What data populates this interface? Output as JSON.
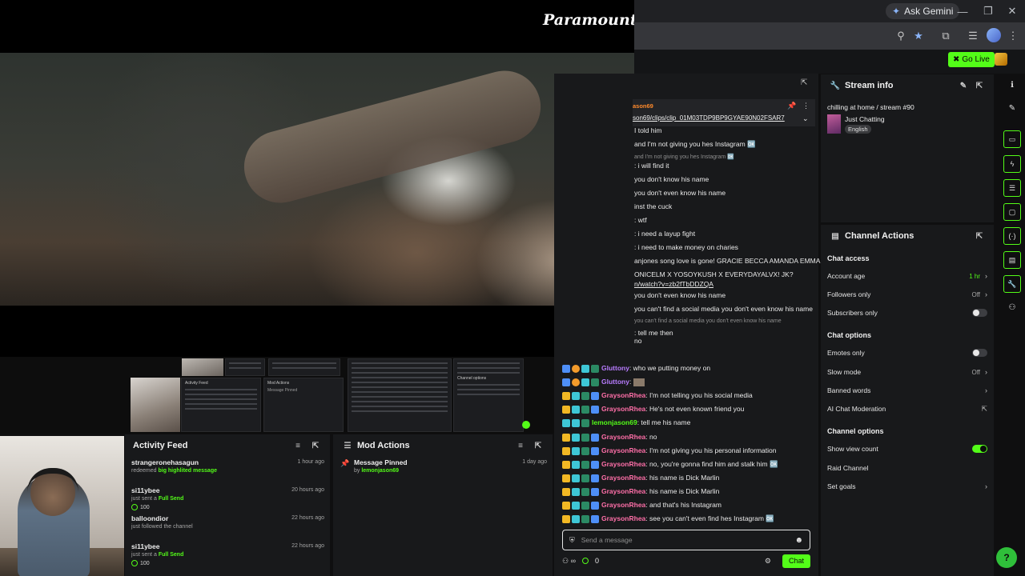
{
  "browser": {
    "ask_gemini": "Ask Gemini",
    "minimize": "—",
    "restore": "❐",
    "close": "✕"
  },
  "video": {
    "logo": "Paramount+"
  },
  "topbar": {
    "go_live": "Go Live"
  },
  "mini": {
    "activity_title": "Activity Feed",
    "mod_title": "Mod Actions",
    "mod_item": "Message Pinned",
    "ch_options": "Channel options"
  },
  "activity_feed": {
    "title": "Activity Feed",
    "items": [
      {
        "name": "strangeronehasagun",
        "time": "1 hour ago",
        "pre": "redeemed ",
        "highlight": "big highlited message",
        "amount": ""
      },
      {
        "name": "si11ybee",
        "time": "20 hours ago",
        "pre": "just sent a ",
        "highlight": "Full Send",
        "amount": "100"
      },
      {
        "name": "balloondior",
        "time": "22 hours ago",
        "pre": "just followed the channel",
        "highlight": "",
        "amount": ""
      },
      {
        "name": "si11ybee",
        "time": "22 hours ago",
        "pre": "just sent a ",
        "highlight": "Full Send",
        "amount": "100"
      }
    ]
  },
  "mod_actions": {
    "title": "Mod Actions",
    "items": [
      {
        "name": "Message Pinned",
        "by": "by ",
        "user": "lemonjason69",
        "time": "1 day ago"
      }
    ]
  },
  "chat": {
    "pinned_user": "ason69",
    "pinned_link": "son69/clips/clip_01M03TDP9BP9GYAE90N02FSAR7",
    "partial_lines": [
      {
        "text": "I told him",
        "dim": false
      },
      {
        "text": "and I'm not giving you hes Instagram 🆗",
        "dim": false
      },
      {
        "text": "and I'm not giving you hes Instagram 🆗",
        "dim": true
      },
      {
        "text": ": i will find it",
        "dim": false
      },
      {
        "text": "you don't know his name",
        "dim": false
      },
      {
        "text": "you don't even know his name",
        "dim": false
      },
      {
        "text": "inst the cuck",
        "dim": false
      },
      {
        "text": ": wtf",
        "dim": false
      },
      {
        "text": ": i need a layup fight",
        "dim": false
      },
      {
        "text": ": i need to make money on charies",
        "dim": false
      },
      {
        "text": "anjones song love is gone! GRACIE BECCA AMANDA EMMA",
        "dim": false
      },
      {
        "text": "ONICELM X YOSOYKUSH X EVERYDAYALVX! JK?",
        "dim": false
      },
      {
        "text": "n/watch?v=zb2fTbDDZQA",
        "dim": false
      },
      {
        "text": "you don't even know his name",
        "dim": false
      },
      {
        "text": "you can't find a social media you don't even know his name",
        "dim": false
      },
      {
        "text": "you can't find a social media you don't even know his name",
        "dim": true
      },
      {
        "text": ": tell me then",
        "dim": false
      },
      {
        "text": "no",
        "dim": false
      }
    ],
    "messages": [
      {
        "user": "Gluttony",
        "color": "purple",
        "text": ": who we putting money on"
      },
      {
        "user": "Gluttony",
        "color": "purple",
        "text": ":"
      },
      {
        "user": "GraysonRhea",
        "color": "pink",
        "text": ": I'm not telling you his social media"
      },
      {
        "user": "GraysonRhea",
        "color": "pink",
        "text": ": He's not even known friend you"
      },
      {
        "user": "lemonjason69",
        "color": "green",
        "text": ": tell me his name"
      },
      {
        "user": "GraysonRhea",
        "color": "pink",
        "text": ": no"
      },
      {
        "user": "GraysonRhea",
        "color": "pink",
        "text": ": I'm not giving you his personal information"
      },
      {
        "user": "GraysonRhea",
        "color": "pink",
        "text": ": no, you're gonna find him and stalk him 🆗"
      },
      {
        "user": "GraysonRhea",
        "color": "pink",
        "text": ": his name is Dick Marlin"
      },
      {
        "user": "GraysonRhea",
        "color": "pink",
        "text": ": his name is Dick Marlin"
      },
      {
        "user": "GraysonRhea",
        "color": "pink",
        "text": ": and that's his Instagram"
      },
      {
        "user": "GraysonRhea",
        "color": "pink",
        "text": ": see you can't even find hes Instagram 🆗"
      }
    ],
    "input_placeholder": "Send a message",
    "points": "0",
    "send": "Chat"
  },
  "stream_info": {
    "title": "Stream info",
    "stream_title": "chilling at home / stream #90",
    "category": "Just Chatting",
    "language": "English"
  },
  "channel_actions": {
    "title": "Channel Actions",
    "chat_access": "Chat access",
    "account_age": "Account age",
    "account_age_val": "1 hr",
    "followers_only": "Followers only",
    "followers_only_val": "Off",
    "subscribers_only": "Subscribers only",
    "chat_options": "Chat options",
    "emotes_only": "Emotes only",
    "slow_mode": "Slow mode",
    "slow_mode_val": "Off",
    "banned_words": "Banned words",
    "ai_moderation": "AI Chat Moderation",
    "channel_options": "Channel options",
    "show_view_count": "Show view count",
    "raid_channel": "Raid Channel",
    "set_goals": "Set goals"
  },
  "colors": {
    "accent": "#53fc18",
    "panel": "#18191b",
    "background": "#0f0f10"
  }
}
